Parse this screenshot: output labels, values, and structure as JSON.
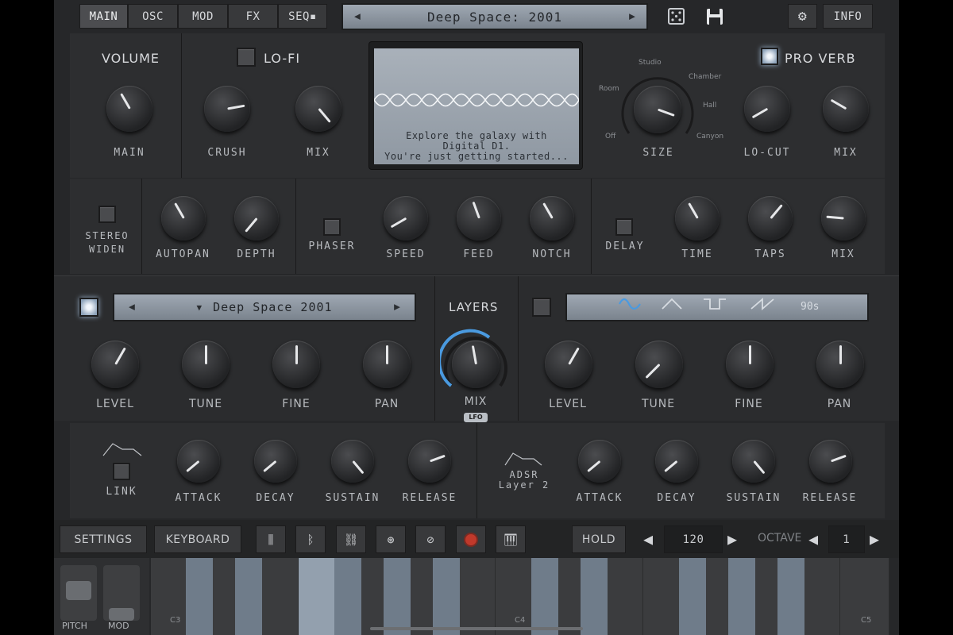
{
  "nav": {
    "tabs": [
      "MAIN",
      "OSC",
      "MOD",
      "FX",
      "SEQ▪"
    ],
    "active_tab": "MAIN",
    "preset_name": "Deep Space: 2001",
    "info_label": "INFO"
  },
  "volume": {
    "title": "VOLUME",
    "knob_label": "MAIN"
  },
  "lofi": {
    "title": "LO-FI",
    "knobs": [
      "CRUSH",
      "MIX"
    ]
  },
  "display": {
    "line1": "Explore the galaxy with",
    "line2": "Digital D1.",
    "line3": "You're just getting started..."
  },
  "reverb": {
    "title": "PRO VERB",
    "size_label": "SIZE",
    "room_types": [
      "Studio",
      "Room",
      "Chamber",
      "Hall",
      "Off",
      "Canyon"
    ],
    "knobs": [
      "LO-CUT",
      "MIX"
    ]
  },
  "fx_row": {
    "stereo": "STEREO WIDEN",
    "stereo_line1": "STEREO",
    "stereo_line2": "WIDEN",
    "autopan": [
      "AUTOPAN",
      "DEPTH"
    ],
    "phaser": "PHASER",
    "phaser_knobs": [
      "SPEED",
      "FEED",
      "NOTCH"
    ],
    "delay": "DELAY",
    "delay_knobs": [
      "TIME",
      "TAPS",
      "MIX"
    ]
  },
  "layer1": {
    "preset": "Deep Space 2001",
    "knobs": [
      "LEVEL",
      "TUNE",
      "FINE",
      "PAN"
    ]
  },
  "layers": {
    "title": "LAYERS",
    "mix_label": "MIX",
    "lfo_badge": "LFO"
  },
  "layer2": {
    "wave_label": "90s",
    "knobs": [
      "LEVEL",
      "TUNE",
      "FINE",
      "PAN"
    ]
  },
  "env1": {
    "link_label": "LINK",
    "knobs": [
      "ATTACK",
      "DECAY",
      "SUSTAIN",
      "RELEASE"
    ]
  },
  "env2": {
    "title1": "ADSR",
    "title2": "Layer 2",
    "knobs": [
      "ATTACK",
      "DECAY",
      "SUSTAIN",
      "RELEASE"
    ]
  },
  "toolbar": {
    "settings": "SETTINGS",
    "keyboard": "KEYBOARD",
    "hold": "HOLD",
    "tempo": "120",
    "octave_label": "OCTAVE",
    "octave_value": "1"
  },
  "keyboard": {
    "pitch_label": "PITCH",
    "mod_label": "MOD",
    "c3": "C3",
    "c4": "C4",
    "c5": "C5"
  },
  "colors": {
    "accent_blue": "#4a9ae0",
    "record_red": "#c0392b",
    "lcd_bg": "#9ca5af"
  }
}
